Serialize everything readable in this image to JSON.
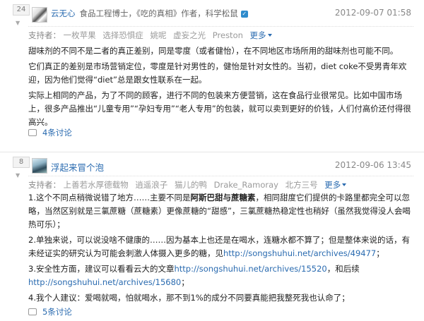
{
  "answers": [
    {
      "votes": "24",
      "author": "云无心",
      "bio": "食品工程博士，《吃的真相》作者，科学松鼠",
      "date": "2012-09-07 01:58",
      "supporters_label": "支持者：",
      "supporters": [
        "一枚苹果",
        "选择恐惧症",
        "姚呢",
        "虚妄之光",
        "Preston"
      ],
      "more": "更多",
      "paragraphs": [
        "甜味剂的不同不是二者的真正差别，同是零度（或者健怡），在不同地区市场所用的甜味剂也可能不同。",
        "它们真正的差别是市场营销定位，零度是针对男性的，健怡是针对女性的。当初，diet coke不受男青年欢迎，因为他们觉得“diet”总是跟女性联系在一起。",
        "实际上相同的产品，为了不同的顾客，进行不同的包装来方便营销，这在食品行业很常见。比如中国市场上，很多产品推出“儿童专用”“孕妇专用”“老人专用”的包装，就可以卖到更好的价钱，人们付高价还付得很高兴。"
      ],
      "discuss": "4条讨论"
    },
    {
      "votes": "8",
      "author": "浮起来冒个泡",
      "date": "2012-09-06 13:45",
      "supporters_label": "支持者：",
      "supporters": [
        "上善若水厚德载物",
        "逍遥浪子",
        "猫儿的鸭",
        "Drake_Ramoray",
        "北方三号"
      ],
      "more": "更多",
      "p1_a": "1.这个不同点稍微说错了地方……主要不同是",
      "p1_b": "阿斯巴甜与蔗糖素",
      "p1_c": "，相同甜度它们提供的卡路里都完全可以忽略，当然区别就是三氯蔗糖（蔗糖素）更像蔗糖的“甜感”，三氯蔗糖热稳定性也稍好（虽然我觉得没人会喝热可乐）；",
      "p2_a": "2.单独来说，可以说没啥不健康的……因为基本上也还是在喝水，连糖水都不算了；但是整体来说的话，有未经证实的研究认为可能会刺激人体摄入更多的糖，见",
      "p2_link": "http://songshuhui.net/archives/49477",
      "p2_end": "；",
      "p3_a": "3.安全性方面，建议可以看看云大的文章",
      "p3_link1": "http://songshuhui.net/archives/15520",
      "p3_mid": "，和后续",
      "p3_link2": "http://songshuhui.net/archives/15680",
      "p3_end": "；",
      "p4": "4.我个人建议：爱喝就喝，怕就喝水，那不到1%的成分不同要真能把我整死我也认命了；",
      "discuss": "5条讨论"
    }
  ]
}
